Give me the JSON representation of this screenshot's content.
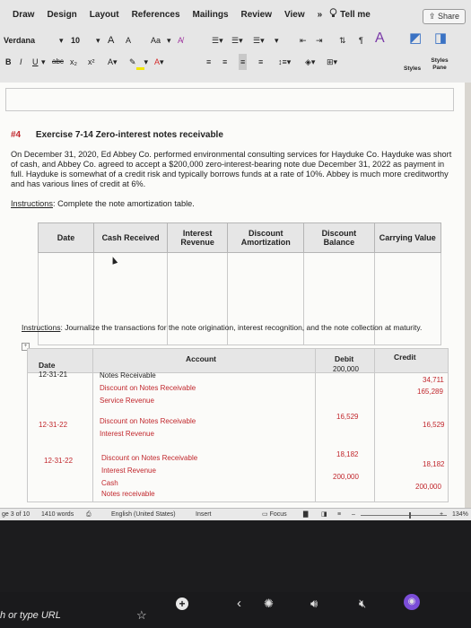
{
  "ribbon": {
    "tabs": [
      "Draw",
      "Design",
      "Layout",
      "References",
      "Mailings",
      "Review",
      "View"
    ],
    "more": "»",
    "tell_me": "Tell me",
    "share": "Share",
    "font_name": "Verdana",
    "font_size": "10",
    "bold": "B",
    "italic": "I",
    "underline": "U",
    "strike": "abc",
    "subscript": "x₂",
    "superscript": "x²",
    "grow_font": "A",
    "shrink_font": "A",
    "change_case": "Aa",
    "paragraph_mark": "¶",
    "styles_label": "Styles",
    "styles_pane_label": "Styles Pane",
    "accent_colors": {
      "highlight": "#f2e600",
      "font_color": "#d42a2a"
    }
  },
  "document": {
    "exercise_number": "#4",
    "exercise_title": "Exercise 7-14   Zero-interest notes receivable",
    "problem_text": "On December 31, 2020, Ed Abbey Co. performed environmental consulting services for Hayduke Co. Hayduke was short of cash, and Abbey Co. agreed to accept a $200,000 zero-interest-bearing note due December 31, 2022 as payment in full. Hayduke is somewhat of a credit risk and typically borrows funds at a rate of 10%. Abbey is much more creditworthy and has various lines of credit at 6%.",
    "instructions_label": "Instructions",
    "instructions1": ": Complete the note amortization table.",
    "amort_headers": [
      "Date",
      "Cash Received",
      "Interest Revenue",
      "Discount Amortization",
      "Discount Balance",
      "Carrying Value"
    ],
    "instructions2": ": Journalize the transactions for the note origination, interest recognition, and the note collection at maturity.",
    "journal_headers": {
      "date": "Date",
      "account": "Account",
      "debit": "Debit",
      "credit": "Credit"
    },
    "journal": {
      "d1": "12-31-21",
      "a1_1": "Notes Receivable",
      "a1_2": "Discount on Notes Receivable",
      "a1_3": "Service Revenue",
      "dr1": "200,000",
      "cr1_1": "34,711",
      "cr1_2": "165,289",
      "d2": "12-31-22",
      "a2_1": "Discount on Notes Receivable",
      "a2_2": "Interest Revenue",
      "dr2": "16,529",
      "cr2": "16,529",
      "d3": "12-31-22",
      "a3_1": "Discount on Notes Receivable",
      "a3_2": "Interest Revenue",
      "a3_3": "Cash",
      "a3_4": "Notes receivable",
      "dr3_1": "18,182",
      "dr3_2": "200,000",
      "cr3_1": "18,182",
      "cr3_2": "200,000"
    }
  },
  "status_bar": {
    "page": "ge 3 of 10",
    "words": "1410 words",
    "language": "English (United States)",
    "mode": "Insert",
    "focus": "Focus",
    "zoom": "134%"
  },
  "browser": {
    "url_placeholder": "h or type URL"
  }
}
